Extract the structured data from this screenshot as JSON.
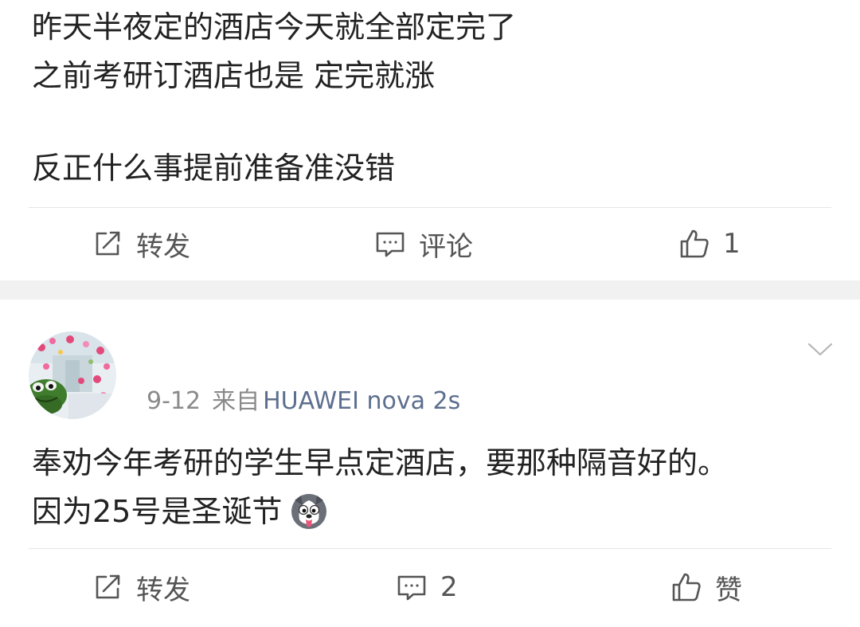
{
  "post1": {
    "lines": [
      "昨天半夜定的酒店今天就全部定完了",
      "之前考研订酒店也是 定完就涨",
      "反正什么事提前准备准没错"
    ],
    "actions": {
      "repost": "转发",
      "comment": "评论",
      "like": "1"
    }
  },
  "post2": {
    "date": "9-12",
    "source_prefix": "来自",
    "device": "HUAWEI nova 2s",
    "lines": [
      "奉劝今年考研的学生早点定酒店，要那种隔音好的。",
      "因为25号是圣诞节"
    ],
    "actions": {
      "repost": "转发",
      "comment": "2",
      "like": "赞"
    }
  },
  "icons": {
    "repost": "repost-icon",
    "comment": "comment-icon",
    "like": "thumbs-up-icon",
    "expand": "chevron-down-icon",
    "emoji": "husky-face-emoji"
  },
  "colors": {
    "text": "#222222",
    "action_text": "#555555",
    "meta_gray": "#8a8a8a",
    "device_blue": "#5d6f8e",
    "separator": "#f1f1f1"
  }
}
